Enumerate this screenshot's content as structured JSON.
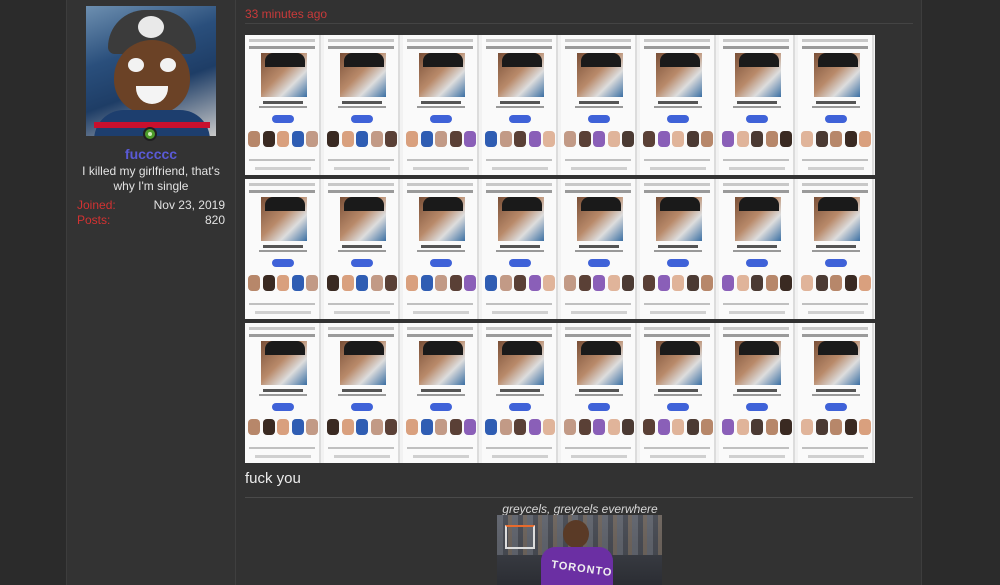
{
  "post": {
    "user": {
      "username": "fuccccc",
      "user_title": "I killed my girlfriend, that's why I'm single",
      "stats": [
        {
          "key": "Joined:",
          "value": "Nov 23, 2019"
        },
        {
          "key": "Posts:",
          "value": "820"
        }
      ],
      "online": true,
      "avatar_icon": "avatar-photo"
    },
    "timestamp": "33 minutes ago",
    "attached_images": [
      {
        "label": "screenshot-strip-1"
      },
      {
        "label": "screenshot-strip-2"
      },
      {
        "label": "screenshot-strip-3"
      }
    ],
    "body_text": "fuck you",
    "signature": {
      "caption": "greycels, greycels everwhere",
      "image_text": "TORONTO"
    }
  },
  "colors": {
    "accent_username": "#5a5ad6",
    "label_red": "#d33232",
    "timestamp_red": "#c93a3a",
    "online_green": "#4c9b2a",
    "background": "#2a2a2a"
  }
}
